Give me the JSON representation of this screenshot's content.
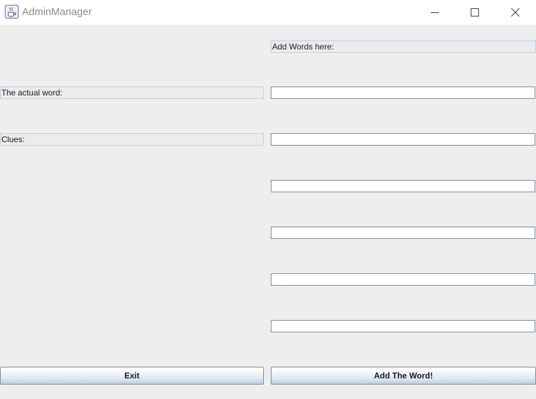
{
  "window": {
    "title": "AdminManager",
    "app_icon": "java-coffee-cup-icon",
    "controls": {
      "minimize_icon": "minimize-icon",
      "maximize_icon": "maximize-icon",
      "close_icon": "close-icon"
    }
  },
  "form": {
    "header_label": "Add Words here:",
    "word_label": "The actual word:",
    "clues_label": "Clues:",
    "word_field": {
      "value": "",
      "placeholder": ""
    },
    "clue_fields": [
      {
        "value": "",
        "placeholder": ""
      },
      {
        "value": "",
        "placeholder": ""
      },
      {
        "value": "",
        "placeholder": ""
      },
      {
        "value": "",
        "placeholder": ""
      },
      {
        "value": "",
        "placeholder": ""
      }
    ]
  },
  "actions": {
    "exit_label": "Exit",
    "add_label": "Add The Word!"
  },
  "colors": {
    "background": "#eeeeee",
    "label_border": "#b8cfe5",
    "field_border": "#7a8a99",
    "title_text": "#8a8a8a"
  }
}
